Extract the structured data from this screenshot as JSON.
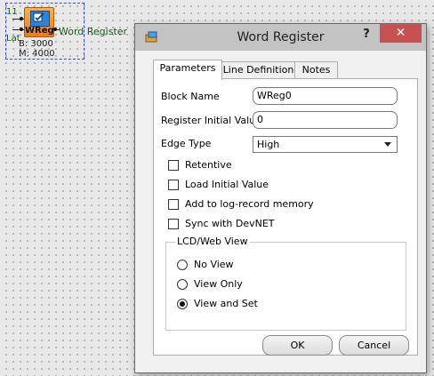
{
  "canvas": {
    "block": {
      "input_top_label": "11",
      "input_bottom_label": "Lat",
      "icon_name": "wreg-block-icon",
      "title": "WReg",
      "output_label": "Word Register",
      "param_b": "B: 3000",
      "param_m": "M: 4000"
    }
  },
  "dialog": {
    "title": "Word Register",
    "help_label": "?",
    "close_label": "✕",
    "tabs": [
      {
        "label": "Parameters",
        "active": true
      },
      {
        "label": "Line Definition",
        "active": false
      },
      {
        "label": "Notes",
        "active": false
      }
    ],
    "fields": {
      "block_name_label": "Block Name",
      "block_name_value": "WReg0",
      "initial_value_label": "Register Initial Value",
      "initial_value_value": "0",
      "edge_type_label": "Edge Type",
      "edge_type_value": "High"
    },
    "checkboxes": [
      {
        "label": "Retentive",
        "checked": false
      },
      {
        "label": "Load Initial Value",
        "checked": false
      },
      {
        "label": "Add to log-record memory",
        "checked": false
      },
      {
        "label": "Sync with DevNET",
        "checked": false
      }
    ],
    "view_group": {
      "title": "LCD/Web View",
      "options": [
        {
          "label": "No View",
          "checked": false
        },
        {
          "label": "View Only",
          "checked": false
        },
        {
          "label": "View and Set",
          "checked": true
        }
      ]
    },
    "buttons": {
      "ok": "OK",
      "cancel": "Cancel"
    }
  },
  "colors": {
    "close_button": "#c75050",
    "titlebar": "#c3c3c3",
    "block_orange": "#f08a1c"
  }
}
